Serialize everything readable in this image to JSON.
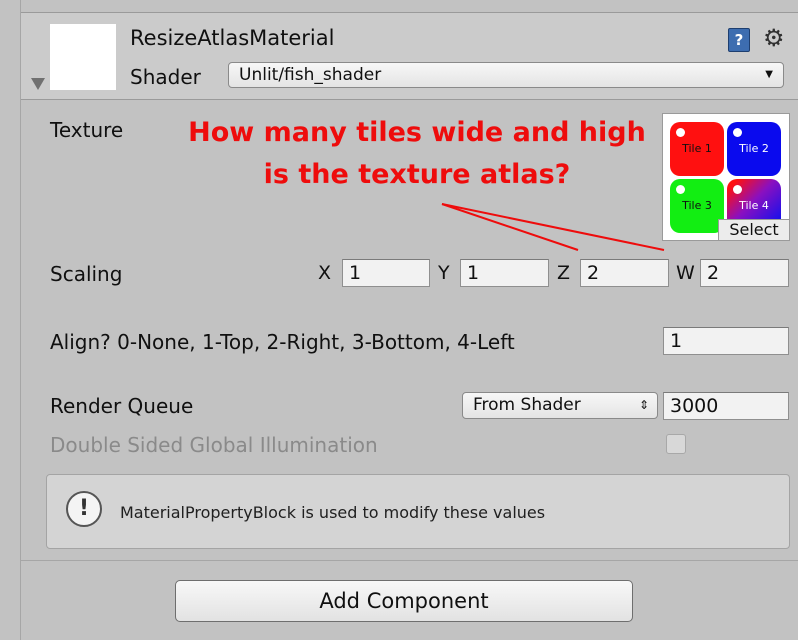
{
  "component": {
    "title": "ResizeAtlasMaterial",
    "shader_label": "Shader",
    "shader_value": "Unlit/fish_shader",
    "help_icon": "help-book-icon",
    "gear_icon": "gear-icon"
  },
  "annotation": {
    "line1": "How many tiles wide and high",
    "line2": "is the texture atlas?",
    "color": "#ee0c0c"
  },
  "texture": {
    "label": "Texture",
    "tiles": [
      {
        "label": "Tile 1",
        "color": "#ff0000"
      },
      {
        "label": "Tile 2",
        "color": "#0000ee"
      },
      {
        "label": "Tile 3",
        "color": "#00ee00"
      },
      {
        "label": "Tile 4",
        "color": "gradient"
      }
    ],
    "select_label": "Select"
  },
  "scaling": {
    "label": "Scaling",
    "fields": [
      {
        "axis": "X",
        "value": "1"
      },
      {
        "axis": "Y",
        "value": "1"
      },
      {
        "axis": "Z",
        "value": "2"
      },
      {
        "axis": "W",
        "value": "2"
      }
    ]
  },
  "align": {
    "label": "Align? 0-None, 1-Top, 2-Right, 3-Bottom, 4-Left",
    "value": "1"
  },
  "render_queue": {
    "label": "Render Queue",
    "mode": "From Shader",
    "value": "3000"
  },
  "dsgi": {
    "label": "Double Sided Global Illumination",
    "checked": false
  },
  "info": {
    "text": "MaterialPropertyBlock is used to modify these values"
  },
  "add_component_label": "Add Component"
}
